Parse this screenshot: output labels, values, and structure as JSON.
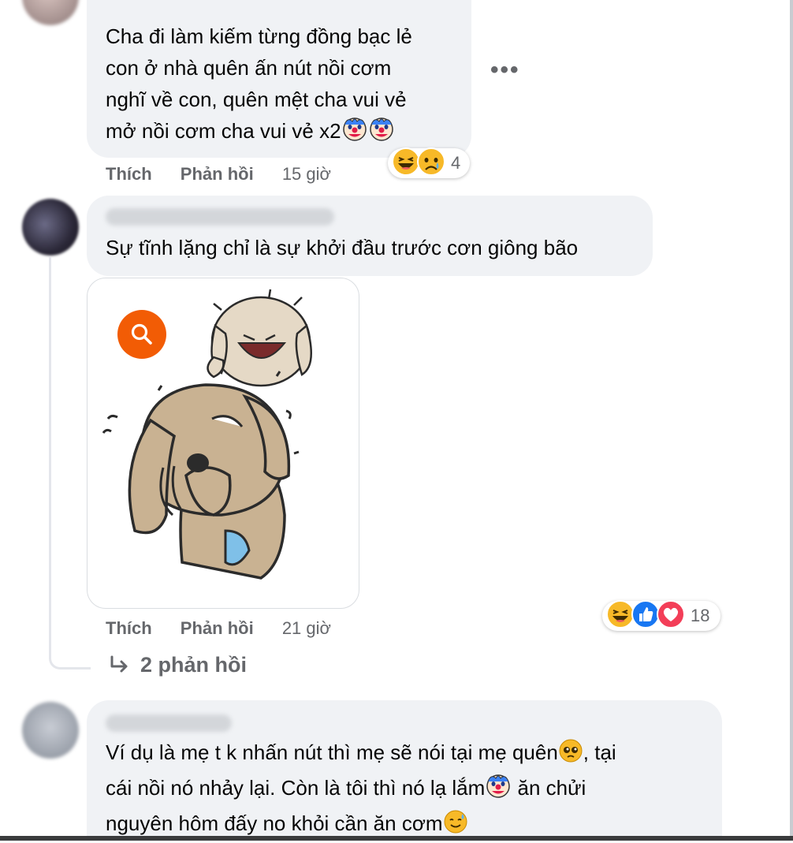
{
  "comments": [
    {
      "lines": [
        "Cha đi làm kiếm từng đồng bạc lẻ",
        "con ở nhà quên ấn nút nồi cơm",
        "nghĩ về con, quên mệt cha vui vẻ",
        "mở nồi cơm cha vui vẻ x2"
      ],
      "actions": {
        "like": "Thích",
        "reply": "Phản hồi",
        "time": "15 giờ"
      },
      "reaction_icons": [
        "haha-icon",
        "sad-icon"
      ],
      "reaction_count": "4"
    },
    {
      "lines": [
        "Sự tĩnh lặng chỉ là sự khởi đầu trước cơn giông bão"
      ],
      "actions": {
        "like": "Thích",
        "reply": "Phản hồi",
        "time": "21 giờ"
      },
      "reaction_icons": [
        "haha-icon",
        "like-icon",
        "love-icon"
      ],
      "reaction_count": "18",
      "replies_link": "2 phản hồi"
    },
    {
      "lines": [
        "Ví dụ là mẹ t k nhấn nút thì mẹ sẽ nói tại mẹ quên",
        ", tại",
        "cái nồi nó nhảy lại. Còn là tôi thì nó lạ lắm",
        " ăn chửi",
        "nguyên hôm đấy no khỏi cần ăn cơm"
      ]
    }
  ],
  "more_options": "•••",
  "colors": {
    "bubble": "#f0f2f5",
    "meta_text": "#65676b",
    "search_button": "#f25c05",
    "like_blue": "#1877f2",
    "love_red": "#f33e58",
    "haha_yellow": "#f7b928"
  }
}
